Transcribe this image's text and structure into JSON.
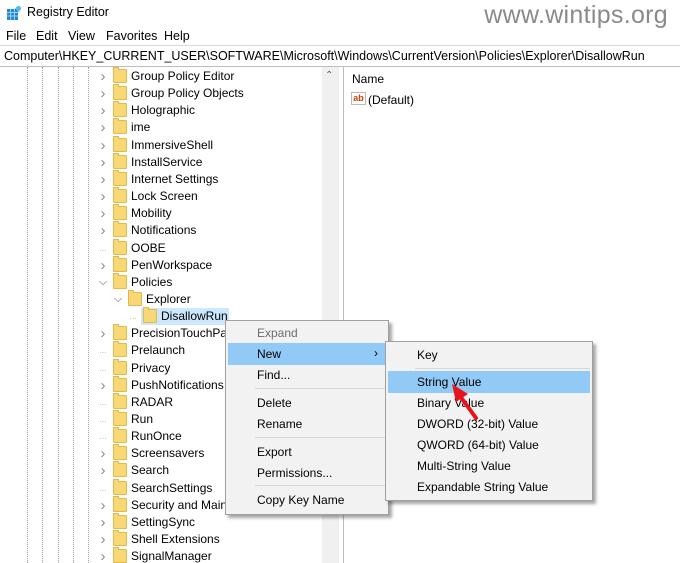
{
  "window": {
    "title": "Registry Editor",
    "watermark": "www.wintips.org"
  },
  "menubar": [
    "File",
    "Edit",
    "View",
    "Favorites",
    "Help"
  ],
  "address": "Computer\\HKEY_CURRENT_USER\\SOFTWARE\\Microsoft\\Windows\\CurrentVersion\\Policies\\Explorer\\DisallowRun",
  "tree": {
    "items": [
      {
        "label": "Group Policy Editor",
        "expander": "collapsed"
      },
      {
        "label": "Group Policy Objects",
        "expander": "collapsed"
      },
      {
        "label": "Holographic",
        "expander": "collapsed"
      },
      {
        "label": "ime",
        "expander": "collapsed"
      },
      {
        "label": "ImmersiveShell",
        "expander": "collapsed"
      },
      {
        "label": "InstallService",
        "expander": "collapsed"
      },
      {
        "label": "Internet Settings",
        "expander": "collapsed"
      },
      {
        "label": "Lock Screen",
        "expander": "collapsed"
      },
      {
        "label": "Mobility",
        "expander": "collapsed"
      },
      {
        "label": "Notifications",
        "expander": "collapsed"
      },
      {
        "label": "OOBE",
        "expander": "none"
      },
      {
        "label": "PenWorkspace",
        "expander": "collapsed"
      },
      {
        "label": "Policies",
        "expander": "expanded"
      },
      {
        "label": "Explorer",
        "expander": "expanded",
        "level": 1
      },
      {
        "label": "DisallowRun",
        "expander": "none",
        "level": 2,
        "selected": true
      },
      {
        "label": "PrecisionTouchPad",
        "expander": "collapsed"
      },
      {
        "label": "Prelaunch",
        "expander": "none"
      },
      {
        "label": "Privacy",
        "expander": "none"
      },
      {
        "label": "PushNotifications",
        "expander": "collapsed"
      },
      {
        "label": "RADAR",
        "expander": "none"
      },
      {
        "label": "Run",
        "expander": "none"
      },
      {
        "label": "RunOnce",
        "expander": "none"
      },
      {
        "label": "Screensavers",
        "expander": "collapsed"
      },
      {
        "label": "Search",
        "expander": "collapsed"
      },
      {
        "label": "SearchSettings",
        "expander": "none"
      },
      {
        "label": "Security and Maintenance",
        "expander": "collapsed"
      },
      {
        "label": "SettingSync",
        "expander": "collapsed"
      },
      {
        "label": "Shell Extensions",
        "expander": "collapsed"
      },
      {
        "label": "SignalManager",
        "expander": "collapsed"
      }
    ]
  },
  "list": {
    "column_name": "Name",
    "values": [
      {
        "name": "(Default)",
        "icon": "string-value-icon"
      }
    ]
  },
  "context_menu": {
    "expand": "Expand",
    "new": "New",
    "find": "Find...",
    "delete": "Delete",
    "rename": "Rename",
    "export": "Export",
    "permissions": "Permissions...",
    "copy_key_name": "Copy Key Name"
  },
  "submenu": {
    "key": "Key",
    "string_value": "String Value",
    "binary_value": "Binary Value",
    "dword_value": "DWORD (32-bit) Value",
    "qword_value": "QWORD (64-bit) Value",
    "multi_string_value": "Multi-String Value",
    "expandable_string_value": "Expandable String Value"
  },
  "colors": {
    "menu_highlight": "#91c9f7",
    "tree_selection": "#cce8ff",
    "annotation_arrow": "#e8141c"
  }
}
